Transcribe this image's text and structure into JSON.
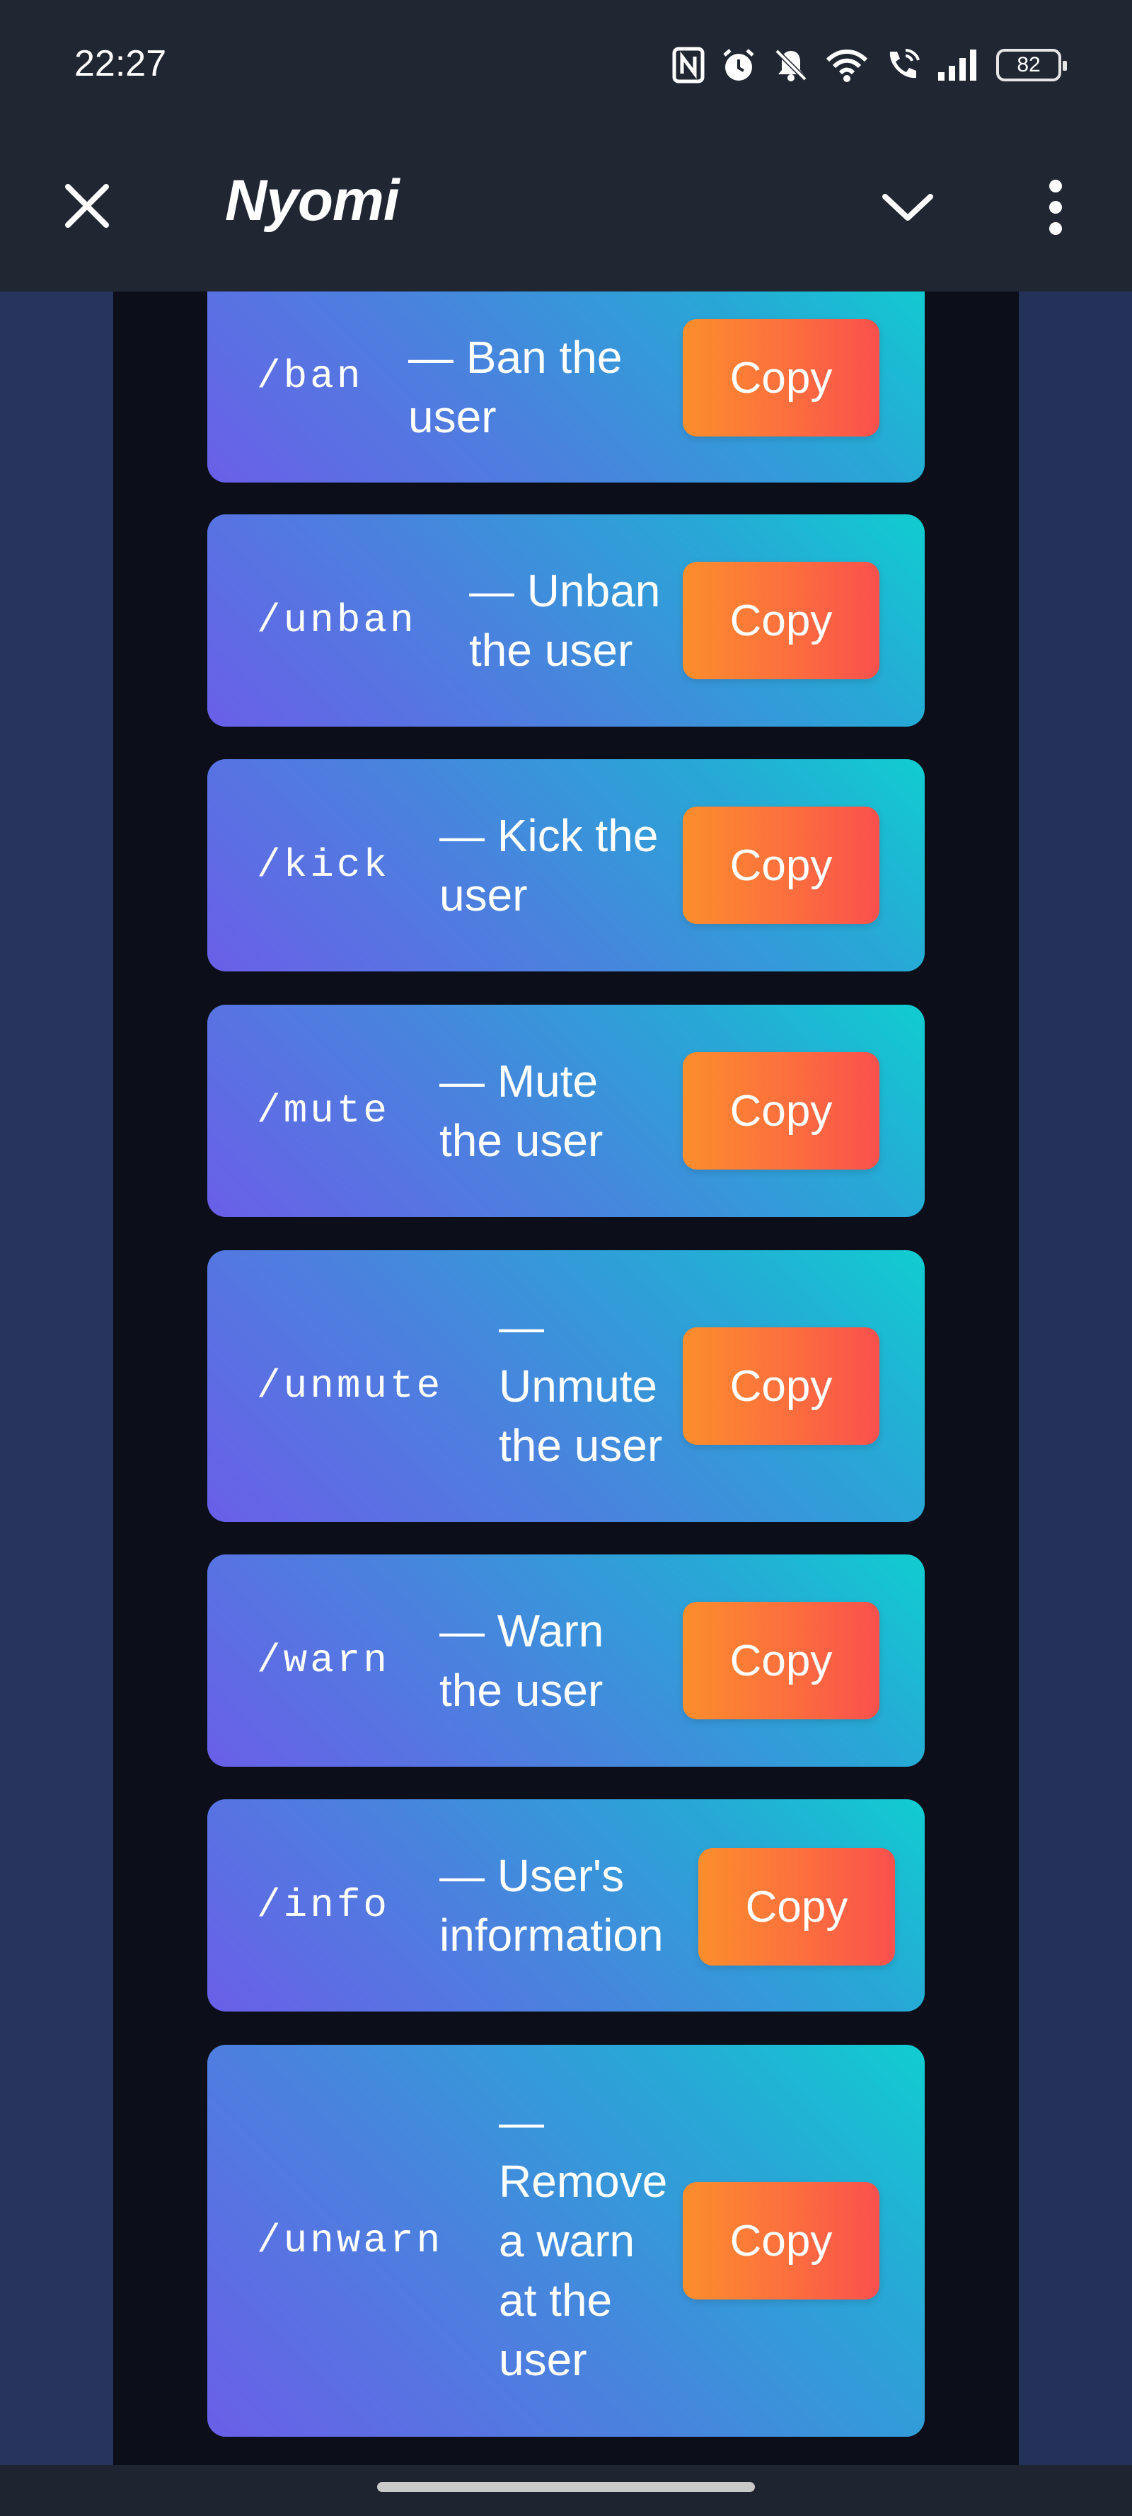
{
  "status_bar": {
    "time": "22:27",
    "battery": "82",
    "icons": [
      "nfc-icon",
      "alarm-icon",
      "mute-icon",
      "wifi-icon",
      "wifi-call-icon",
      "signal-icon",
      "battery-icon"
    ]
  },
  "app_bar": {
    "title": "Nyomi",
    "icons": [
      "close-icon",
      "chevron-down-icon",
      "more-vert-icon"
    ]
  },
  "commands": [
    {
      "command": "/ban",
      "description": [
        "— Ban the",
        "user"
      ],
      "copy_label": "Copy"
    },
    {
      "command": "/unban",
      "description": [
        "— Unban",
        "the user"
      ],
      "copy_label": "Copy"
    },
    {
      "command": "/kick",
      "description": [
        "— Kick the",
        "user"
      ],
      "copy_label": "Copy"
    },
    {
      "command": "/mute",
      "description": [
        "— Mute",
        "the user"
      ],
      "copy_label": "Copy"
    },
    {
      "command": "/unmute",
      "description": [
        "—",
        "Unmute",
        "the user"
      ],
      "copy_label": "Copy"
    },
    {
      "command": "/warn",
      "description": [
        "— Warn",
        "the user"
      ],
      "copy_label": "Copy"
    },
    {
      "command": "/info",
      "description": [
        "— User's",
        "information"
      ],
      "copy_label": "Copy"
    },
    {
      "command": "/unwarn",
      "description": [
        "—",
        "Remove",
        "a warn",
        "at the",
        "user"
      ],
      "copy_label": "Copy"
    }
  ],
  "colors": {
    "card_gradient": [
      "#6a5fe8",
      "#10cdd0"
    ],
    "copy_button_gradient": [
      "#fb8e2c",
      "#f9504d"
    ],
    "app_bar_bg": "#202733",
    "panel_bg": "#0c0f1a"
  }
}
